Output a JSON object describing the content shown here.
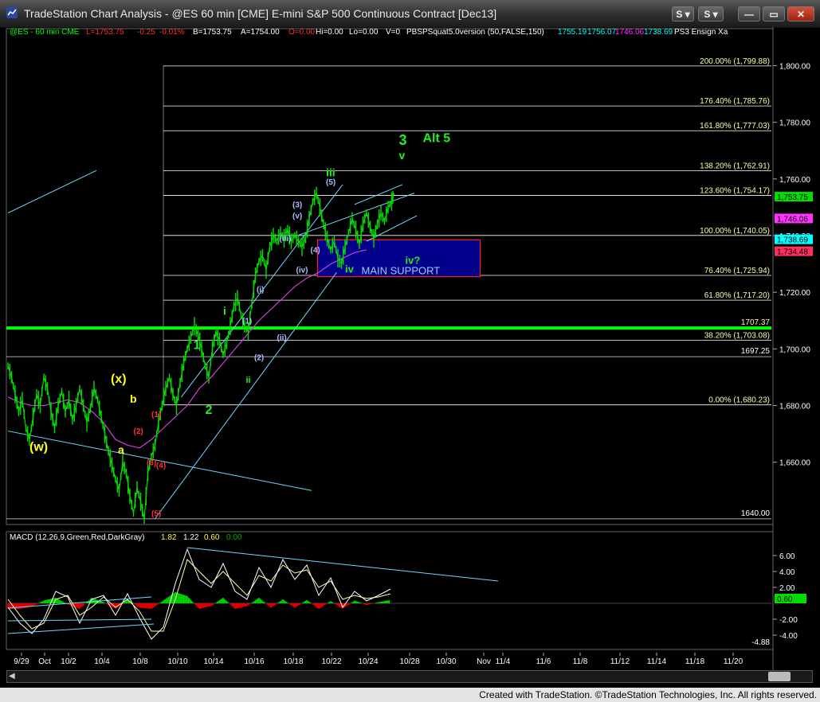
{
  "window": {
    "title": "TradeStation Chart Analysis - @ES 60 min [CME] E-mini S&P 500 Continuous Contract [Dec13]",
    "buttons": [
      {
        "id": "s-button",
        "label": "S"
      },
      {
        "id": "link-button",
        "label": "S"
      },
      {
        "id": "minimize-button",
        "label": "—"
      },
      {
        "id": "restore-button",
        "label": "▭"
      },
      {
        "id": "close-button",
        "label": "✕"
      }
    ]
  },
  "status_bar": {
    "text": "Created with TradeStation. ©TradeStation Technologies, Inc. All rights reserved."
  },
  "colors": {
    "price": "#00e000",
    "fib": "#ffffff",
    "fib_text": "#ffffaa",
    "channel": "#6ed8ff",
    "magenta": "#d040d0",
    "support_box": "#00008b",
    "support_border": "#ff2020",
    "wave_green": "#22ee22",
    "wave_yellow": "#ffff22",
    "wave_red": "#ff3030",
    "wave_blue": "#aabbff"
  },
  "chart_data": [
    {
      "type": "line",
      "name": "price",
      "header": {
        "symbol": "@ES - 60 min  CME",
        "last": "L=1753.75",
        "chg": "-0.25",
        "pct": "-0.01%",
        "bid": "B=1753.75",
        "ask": "A=1754.00",
        "offer": "O=0.00",
        "hi": "Hi=0.00",
        "lo": "Lo=0.00",
        "vol": "V=0",
        "indicator": "PBSPSquat5.0version (50,FALSE,150)",
        "ind_values": [
          "1755.19",
          "1756.07",
          "1746.06",
          "1738.69"
        ],
        "ensign": "PS3 Ensign Xa"
      },
      "ylim": [
        1638,
        1808
      ],
      "y_ticks": [
        "1,800.00",
        "1,780.00",
        "1,760.00",
        "1,740.00",
        "1,720.00",
        "1,700.00",
        "1,680.00",
        "1,660.00"
      ],
      "x_ticks": [
        "9/29",
        "Oct",
        "10/2",
        "10/4",
        "10/8",
        "10/10",
        "10/14",
        "10/16",
        "10/18",
        "10/22",
        "10/24",
        "10/28",
        "10/30",
        "Nov",
        "11/4",
        "11/6",
        "11/8",
        "11/12",
        "11/14",
        "11/18",
        "11/20"
      ],
      "price_path": [
        [
          0,
          1694
        ],
        [
          3,
          1690
        ],
        [
          6,
          1684
        ],
        [
          9,
          1678
        ],
        [
          12,
          1682
        ],
        [
          15,
          1672
        ],
        [
          18,
          1668
        ],
        [
          21,
          1676
        ],
        [
          24,
          1684
        ],
        [
          27,
          1680
        ],
        [
          30,
          1690
        ],
        [
          33,
          1686
        ],
        [
          36,
          1678
        ],
        [
          39,
          1672
        ],
        [
          42,
          1680
        ],
        [
          45,
          1685
        ],
        [
          48,
          1678
        ],
        [
          51,
          1682
        ],
        [
          54,
          1675
        ],
        [
          57,
          1680
        ],
        [
          60,
          1686
        ],
        [
          63,
          1680
        ],
        [
          66,
          1674
        ],
        [
          69,
          1679
        ],
        [
          72,
          1686
        ],
        [
          75,
          1682
        ],
        [
          78,
          1676
        ],
        [
          81,
          1670
        ],
        [
          84,
          1664
        ],
        [
          87,
          1659
        ],
        [
          90,
          1654
        ],
        [
          93,
          1650
        ],
        [
          96,
          1660
        ],
        [
          99,
          1656
        ],
        [
          102,
          1648
        ],
        [
          105,
          1642
        ],
        [
          108,
          1651
        ],
        [
          111,
          1646
        ],
        [
          114,
          1640
        ],
        [
          117,
          1656
        ],
        [
          120,
          1662
        ],
        [
          123,
          1666
        ],
        [
          126,
          1674
        ],
        [
          129,
          1680
        ],
        [
          132,
          1686
        ],
        [
          135,
          1690
        ],
        [
          138,
          1684
        ],
        [
          141,
          1680
        ],
        [
          144,
          1688
        ],
        [
          147,
          1695
        ],
        [
          150,
          1700
        ],
        [
          153,
          1704
        ],
        [
          156,
          1708
        ],
        [
          159,
          1705
        ],
        [
          162,
          1700
        ],
        [
          165,
          1694
        ],
        [
          168,
          1690
        ],
        [
          171,
          1700
        ],
        [
          174,
          1706
        ],
        [
          177,
          1703
        ],
        [
          180,
          1698
        ],
        [
          183,
          1702
        ],
        [
          186,
          1708
        ],
        [
          189,
          1715
        ],
        [
          192,
          1718
        ],
        [
          195,
          1712
        ],
        [
          198,
          1708
        ],
        [
          201,
          1706
        ],
        [
          204,
          1716
        ],
        [
          207,
          1726
        ],
        [
          210,
          1731
        ],
        [
          213,
          1733
        ],
        [
          216,
          1728
        ],
        [
          219,
          1736
        ],
        [
          222,
          1740
        ],
        [
          225,
          1738
        ],
        [
          228,
          1741
        ],
        [
          231,
          1739
        ],
        [
          234,
          1742
        ],
        [
          237,
          1738
        ],
        [
          240,
          1740
        ],
        [
          243,
          1738
        ],
        [
          246,
          1736
        ],
        [
          249,
          1739
        ],
        [
          252,
          1746
        ],
        [
          255,
          1752
        ],
        [
          258,
          1755
        ],
        [
          261,
          1750
        ],
        [
          264,
          1744
        ],
        [
          267,
          1739
        ],
        [
          270,
          1735
        ],
        [
          273,
          1738
        ],
        [
          276,
          1732
        ],
        [
          279,
          1730
        ],
        [
          282,
          1736
        ],
        [
          285,
          1741
        ],
        [
          288,
          1746
        ],
        [
          291,
          1742
        ],
        [
          294,
          1737
        ],
        [
          297,
          1744
        ],
        [
          300,
          1748
        ],
        [
          303,
          1743
        ],
        [
          306,
          1739
        ],
        [
          309,
          1744
        ],
        [
          312,
          1748
        ],
        [
          315,
          1745
        ],
        [
          318,
          1750
        ],
        [
          321,
          1752
        ],
        [
          323,
          1755
        ]
      ],
      "magenta_path": [
        [
          0,
          1683
        ],
        [
          10,
          1681
        ],
        [
          20,
          1680
        ],
        [
          30,
          1680
        ],
        [
          40,
          1681
        ],
        [
          50,
          1682
        ],
        [
          60,
          1681
        ],
        [
          70,
          1678
        ],
        [
          80,
          1674
        ],
        [
          90,
          1668
        ],
        [
          100,
          1666
        ],
        [
          110,
          1665
        ],
        [
          120,
          1668
        ],
        [
          130,
          1672
        ],
        [
          140,
          1676
        ],
        [
          150,
          1680
        ],
        [
          160,
          1686
        ],
        [
          170,
          1690
        ],
        [
          180,
          1695
        ],
        [
          190,
          1700
        ],
        [
          200,
          1705
        ],
        [
          210,
          1710
        ],
        [
          220,
          1714
        ],
        [
          230,
          1718
        ],
        [
          240,
          1722
        ],
        [
          250,
          1725
        ],
        [
          260,
          1727
        ],
        [
          270,
          1730
        ],
        [
          280,
          1732
        ],
        [
          290,
          1734
        ],
        [
          300,
          1735
        ]
      ],
      "fib_levels": [
        {
          "label": "200.00% (1,799.88)",
          "value": 1799.88
        },
        {
          "label": "176.40% (1,785.76)",
          "value": 1785.76
        },
        {
          "label": "161.80% (1,777.03)",
          "value": 1777.03
        },
        {
          "label": "138.20% (1,762.91)",
          "value": 1762.91
        },
        {
          "label": "123.60% (1,754.17)",
          "value": 1754.17
        },
        {
          "label": "100.00% (1,740.05)",
          "value": 1740.05
        },
        {
          "label": "76.40% (1,725.94)",
          "value": 1725.94
        },
        {
          "label": "61.80% (1,717.20)",
          "value": 1717.2
        },
        {
          "label": "38.20% (1,703.08)",
          "value": 1703.08
        },
        {
          "label": "0.00% (1,680.23)",
          "value": 1680.23
        }
      ],
      "h_lines": [
        {
          "label": "1707.37",
          "value": 1707.37
        },
        {
          "label": "1697.25",
          "value": 1697.25
        },
        {
          "label": "1640.00",
          "value": 1640.0
        }
      ],
      "right_labels": [
        {
          "label": "1,753.75",
          "value": 1753.75,
          "color": "#00e000"
        },
        {
          "label": "1,746.06",
          "value": 1746.06,
          "color": "#ff33ff"
        },
        {
          "label": "1,738.69",
          "value": 1738.69,
          "color": "#00ffff"
        },
        {
          "label": "1,734.48",
          "value": 1734.48,
          "color": "#ff3060"
        }
      ],
      "support_box": {
        "label": "MAIN SUPPORT",
        "wave": "iv?",
        "x0": 259,
        "x1": 395,
        "y0": 1725.5,
        "y1": 1738.5
      },
      "wave_labels": [
        {
          "t": "(w)",
          "x": 18,
          "y": 1664,
          "c": "wave_yellow",
          "s": 16
        },
        {
          "t": "(x)",
          "x": 86,
          "y": 1688,
          "c": "wave_yellow",
          "s": 16
        },
        {
          "t": "a",
          "x": 92,
          "y": 1663,
          "c": "wave_yellow",
          "s": 14
        },
        {
          "t": "b",
          "x": 102,
          "y": 1681,
          "c": "wave_yellow",
          "s": 14
        },
        {
          "t": "(1)",
          "x": 120,
          "y": 1676,
          "c": "wave_red",
          "s": 10
        },
        {
          "t": "(2)",
          "x": 105,
          "y": 1670,
          "c": "wave_red",
          "s": 10
        },
        {
          "t": "(3)",
          "x": 116,
          "y": 1659,
          "c": "wave_red",
          "s": 10
        },
        {
          "t": "(4)",
          "x": 124,
          "y": 1658,
          "c": "wave_red",
          "s": 10
        },
        {
          "t": "(5)",
          "x": 120,
          "y": 1641,
          "c": "wave_red",
          "s": 10
        },
        {
          "t": "1",
          "x": 155,
          "y": 1700,
          "c": "wave_green",
          "s": 16
        },
        {
          "t": "2",
          "x": 165,
          "y": 1677,
          "c": "wave_green",
          "s": 16
        },
        {
          "t": "i",
          "x": 180,
          "y": 1712,
          "c": "wave_green",
          "s": 14
        },
        {
          "t": "ii",
          "x": 199,
          "y": 1688,
          "c": "wave_green",
          "s": 11
        },
        {
          "t": "(1)",
          "x": 196,
          "y": 1709,
          "c": "wave_blue",
          "s": 10
        },
        {
          "t": "(2)",
          "x": 206,
          "y": 1696,
          "c": "wave_blue",
          "s": 10
        },
        {
          "t": "(i)",
          "x": 208,
          "y": 1720,
          "c": "wave_blue",
          "s": 10
        },
        {
          "t": "(ii)",
          "x": 225,
          "y": 1703,
          "c": "wave_blue",
          "s": 10
        },
        {
          "t": "(iii)",
          "x": 227,
          "y": 1738,
          "c": "wave_blue",
          "s": 10
        },
        {
          "t": "(iv)",
          "x": 241,
          "y": 1727,
          "c": "wave_blue",
          "s": 10
        },
        {
          "t": "(3)",
          "x": 238,
          "y": 1750,
          "c": "wave_blue",
          "s": 10
        },
        {
          "t": "(v)",
          "x": 238,
          "y": 1746,
          "c": "wave_blue",
          "s": 10
        },
        {
          "t": "(4)",
          "x": 253,
          "y": 1734,
          "c": "wave_blue",
          "s": 10
        },
        {
          "t": "(5)",
          "x": 266,
          "y": 1758,
          "c": "wave_blue",
          "s": 10
        },
        {
          "t": "iii",
          "x": 266,
          "y": 1761,
          "c": "wave_green",
          "s": 14
        },
        {
          "t": "iv",
          "x": 282,
          "y": 1727,
          "c": "wave_green",
          "s": 13
        },
        {
          "t": "3",
          "x": 327,
          "y": 1772,
          "c": "wave_green",
          "s": 18
        },
        {
          "t": "v",
          "x": 327,
          "y": 1767,
          "c": "wave_green",
          "s": 14
        },
        {
          "t": "Alt 5",
          "x": 347,
          "y": 1773,
          "c": "wave_green",
          "s": 16
        }
      ]
    },
    {
      "type": "line",
      "name": "MACD",
      "header": {
        "label": "MACD (12,26,9,Green,Red,DarkGray)",
        "v1": "1.82",
        "v2": "1.22",
        "v3": "0.60",
        "v4": "0.00"
      },
      "ylim": [
        -5.6,
        7.6
      ],
      "y_ticks": [
        "6.00",
        "4.00",
        "2.00",
        "-2.00",
        "-4.00"
      ],
      "bottom_label": "-4.88",
      "right_label": "0.60",
      "macd_path": [
        [
          0,
          -0.5
        ],
        [
          10,
          -2.5
        ],
        [
          20,
          -3.8
        ],
        [
          30,
          -2.0
        ],
        [
          40,
          1.5
        ],
        [
          50,
          0.8
        ],
        [
          60,
          -2.5
        ],
        [
          70,
          0.5
        ],
        [
          80,
          1.0
        ],
        [
          90,
          -1.5
        ],
        [
          100,
          1.2
        ],
        [
          110,
          -1.8
        ],
        [
          120,
          -4.5
        ],
        [
          130,
          -3.0
        ],
        [
          140,
          2.5
        ],
        [
          150,
          6.8
        ],
        [
          160,
          3.0
        ],
        [
          170,
          2.0
        ],
        [
          180,
          5.0
        ],
        [
          190,
          1.5
        ],
        [
          200,
          0.5
        ],
        [
          210,
          4.5
        ],
        [
          220,
          2.0
        ],
        [
          230,
          5.5
        ],
        [
          240,
          3.0
        ],
        [
          250,
          4.8
        ],
        [
          260,
          1.0
        ],
        [
          270,
          3.2
        ],
        [
          280,
          -0.5
        ],
        [
          290,
          1.5
        ],
        [
          300,
          0.3
        ],
        [
          310,
          1.0
        ],
        [
          320,
          1.8
        ]
      ],
      "signal_path": [
        [
          0,
          0.5
        ],
        [
          10,
          -1.5
        ],
        [
          20,
          -3.2
        ],
        [
          30,
          -2.5
        ],
        [
          40,
          0.5
        ],
        [
          50,
          1.0
        ],
        [
          60,
          -1.5
        ],
        [
          70,
          -0.5
        ],
        [
          80,
          0.8
        ],
        [
          90,
          -0.5
        ],
        [
          100,
          0.5
        ],
        [
          110,
          -1.0
        ],
        [
          120,
          -3.5
        ],
        [
          130,
          -3.5
        ],
        [
          140,
          0.5
        ],
        [
          150,
          5.5
        ],
        [
          160,
          4.0
        ],
        [
          170,
          2.5
        ],
        [
          180,
          4.0
        ],
        [
          190,
          2.5
        ],
        [
          200,
          1.0
        ],
        [
          210,
          3.5
        ],
        [
          220,
          2.8
        ],
        [
          230,
          4.8
        ],
        [
          240,
          3.8
        ],
        [
          250,
          4.2
        ],
        [
          260,
          2.0
        ],
        [
          270,
          2.8
        ],
        [
          280,
          0.5
        ],
        [
          290,
          1.0
        ],
        [
          300,
          0.6
        ],
        [
          310,
          0.8
        ],
        [
          320,
          1.2
        ]
      ]
    }
  ]
}
